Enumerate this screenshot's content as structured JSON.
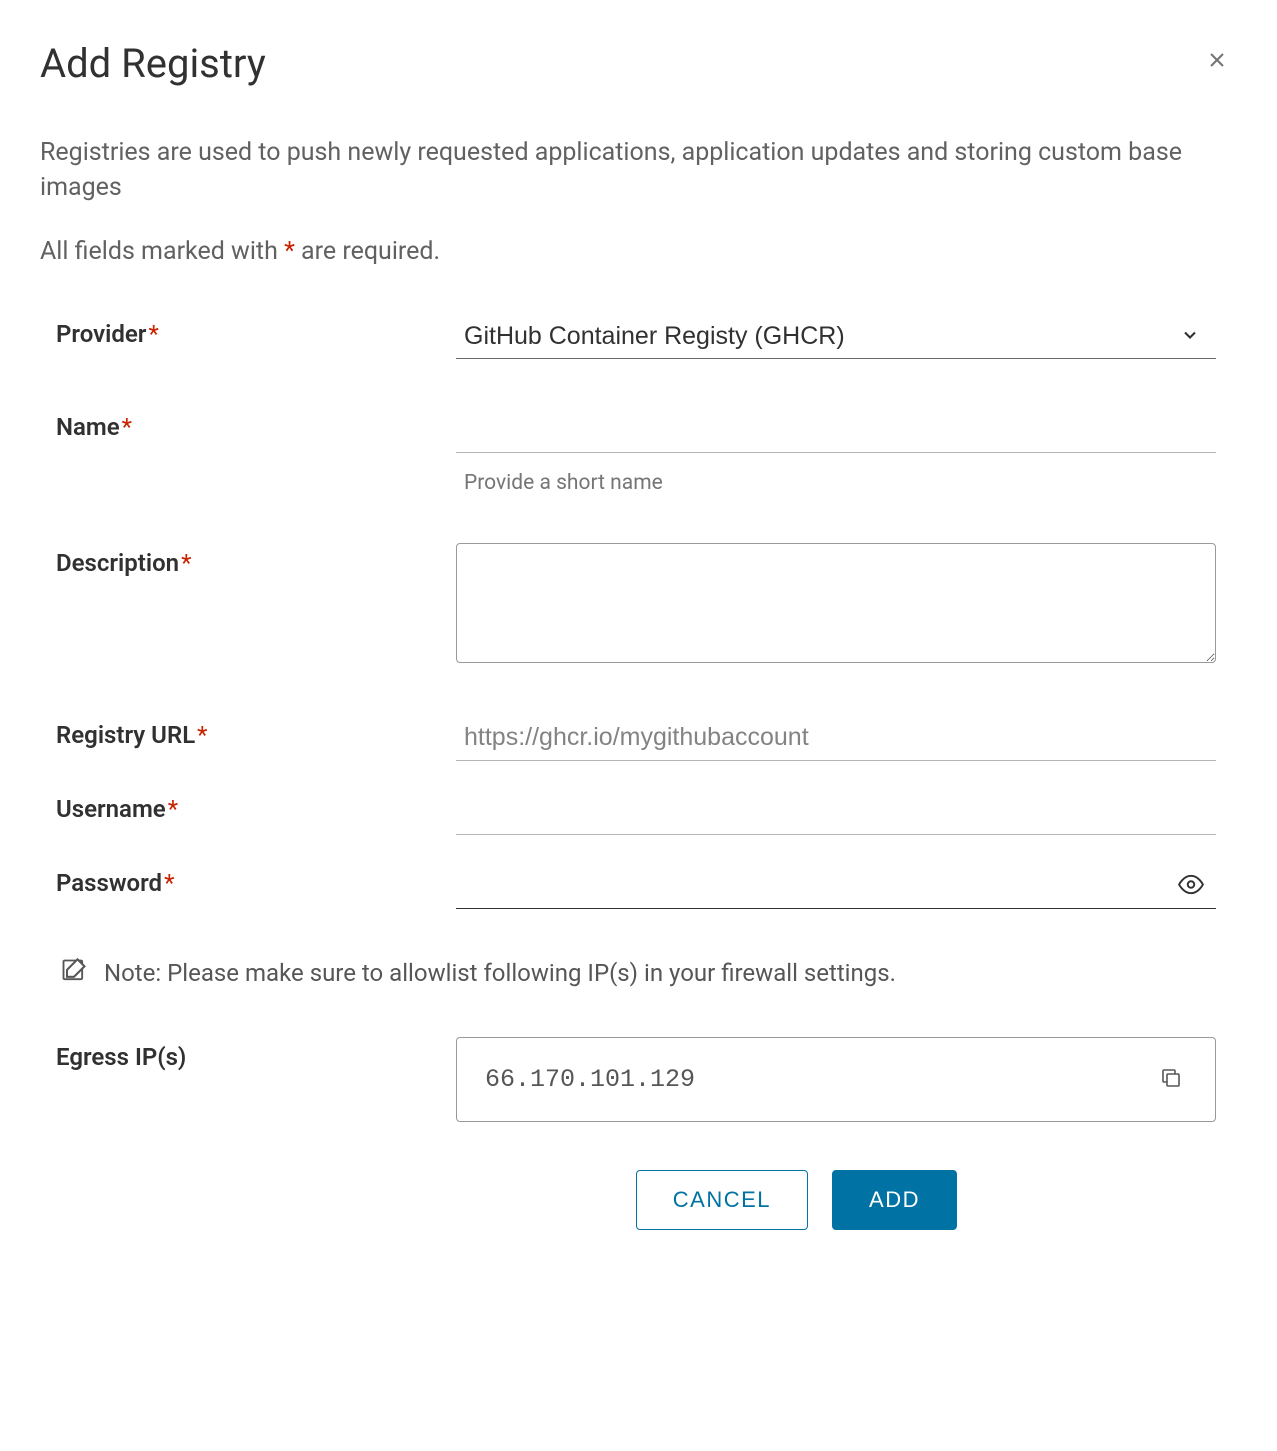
{
  "header": {
    "title": "Add Registry"
  },
  "intro": {
    "description": "Registries are used to push newly requested applications, application updates and storing custom base images",
    "required_prefix": "All fields marked with ",
    "required_asterisk": "*",
    "required_suffix": " are required."
  },
  "form": {
    "provider": {
      "label": "Provider",
      "value": "GitHub Container Registy (GHCR)"
    },
    "name": {
      "label": "Name",
      "value": "",
      "hint": "Provide a short name"
    },
    "description": {
      "label": "Description",
      "value": ""
    },
    "registry_url": {
      "label": "Registry URL",
      "value": "",
      "placeholder": "https://ghcr.io/mygithubaccount"
    },
    "username": {
      "label": "Username",
      "value": ""
    },
    "password": {
      "label": "Password",
      "value": ""
    },
    "note": "Note: Please make sure to allowlist following IP(s) in your firewall settings.",
    "egress": {
      "label": "Egress IP(s)",
      "value": "66.170.101.129"
    }
  },
  "footer": {
    "cancel": "CANCEL",
    "add": "ADD"
  }
}
